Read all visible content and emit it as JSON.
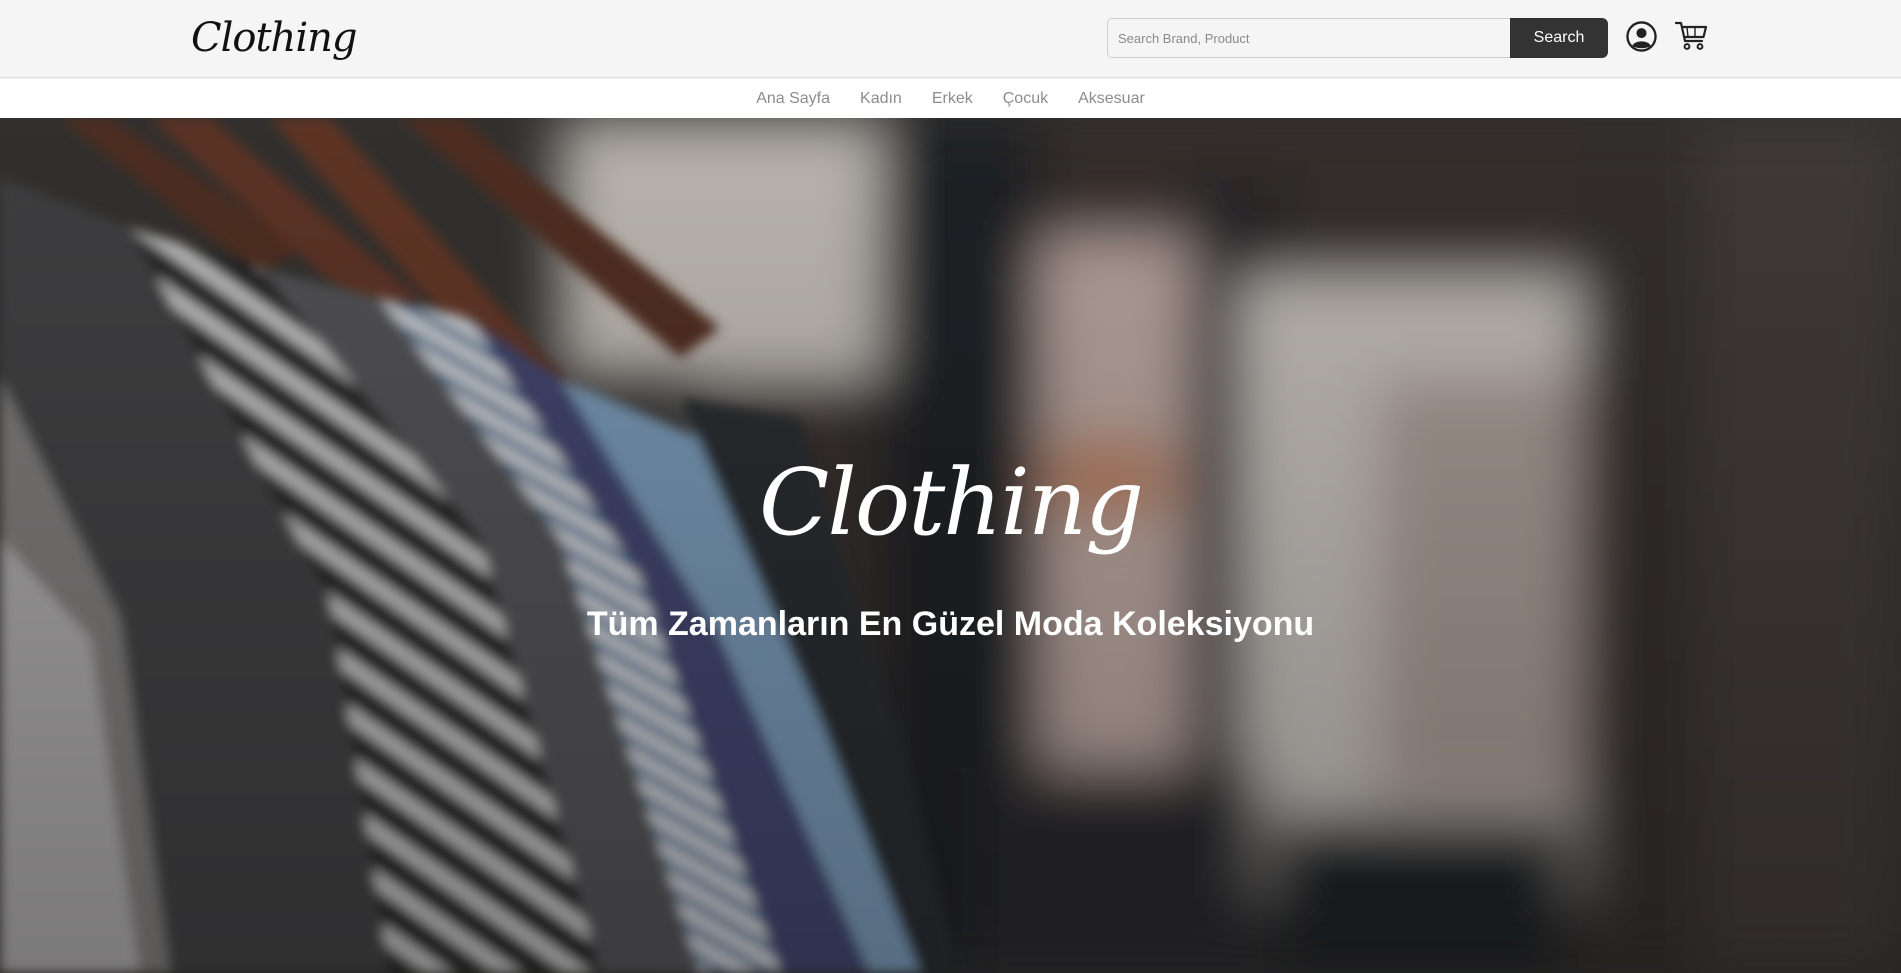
{
  "header": {
    "logo_text": "Clothing",
    "search": {
      "placeholder": "Search Brand, Product",
      "value": "",
      "button_label": "Search"
    },
    "icons": [
      "user-circle-icon",
      "shopping-cart-icon"
    ]
  },
  "nav": {
    "items": [
      {
        "label": "Ana Sayfa"
      },
      {
        "label": "Kadın"
      },
      {
        "label": "Erkek"
      },
      {
        "label": "Çocuk"
      },
      {
        "label": "Aksesuar"
      }
    ]
  },
  "hero": {
    "logo_text": "Clothing",
    "tagline": "Tüm Zamanların En Güzel Moda Koleksiyonu"
  },
  "colors": {
    "page_bg": "#f5f5f5",
    "search_button": "#333333",
    "nav_text": "#8c8c8c",
    "hero_text": "#ffffff"
  }
}
